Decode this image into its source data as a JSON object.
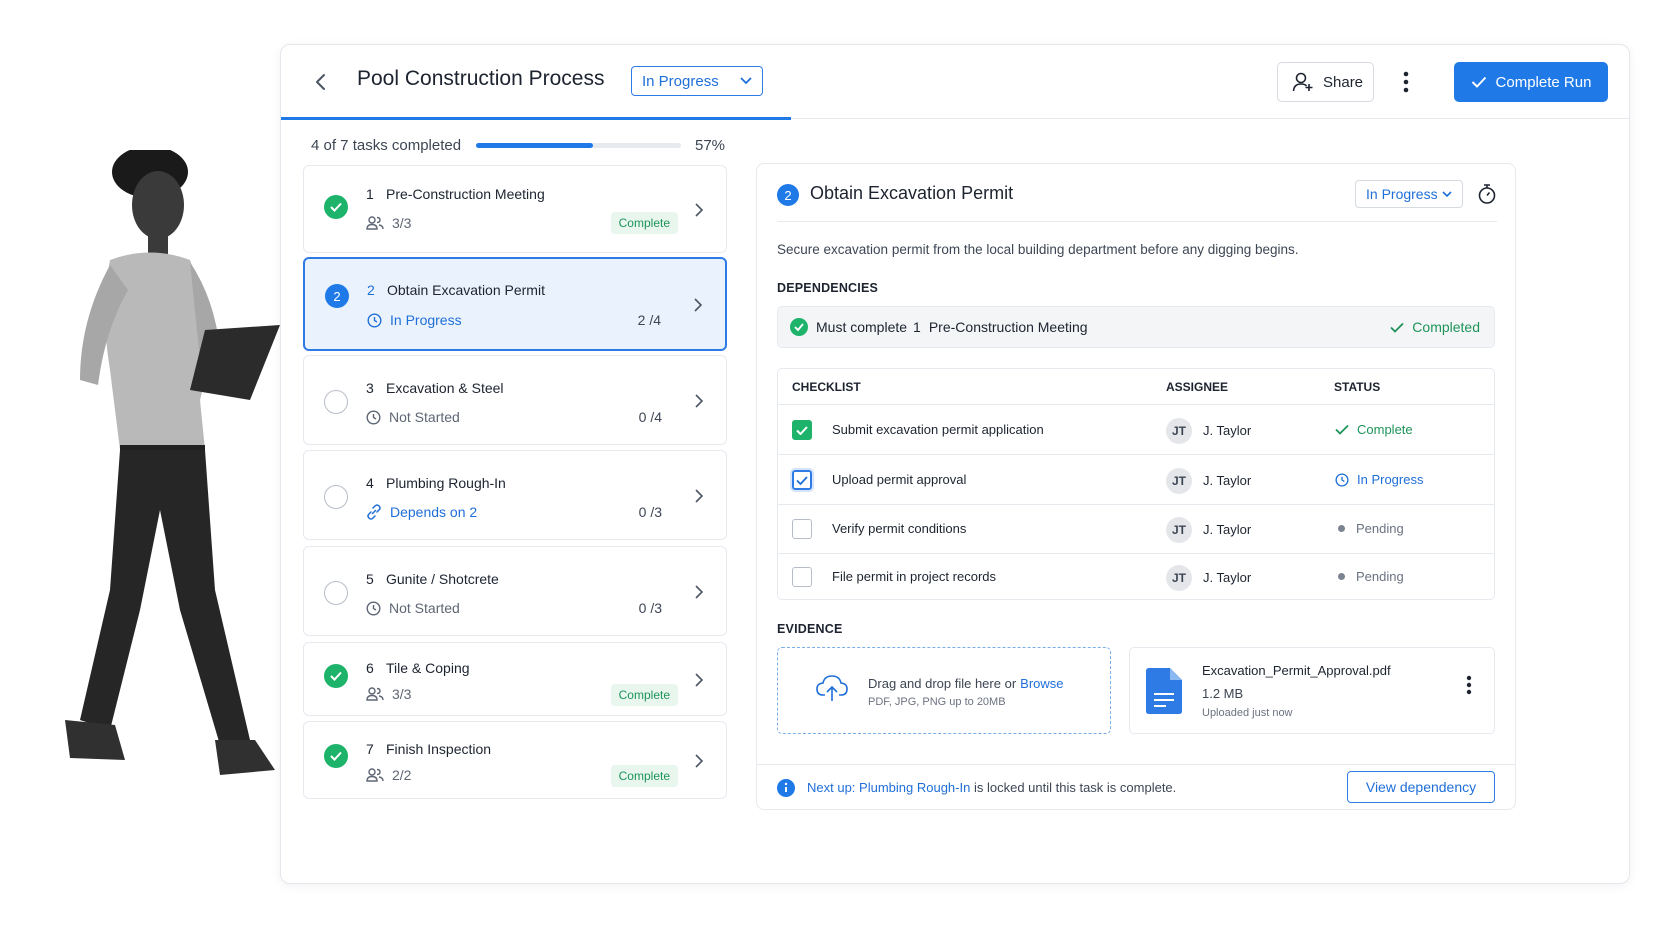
{
  "header": {
    "title": "Pool Construction Process",
    "status": "In Progress",
    "share_label": "Share",
    "complete_run_label": "Complete Run"
  },
  "progress": {
    "text": "4 of 7 tasks completed",
    "percent_label": "57%",
    "fraction": 0.57
  },
  "tasks": [
    {
      "num": "1",
      "title": "Pre-Construction Meeting",
      "state": "done",
      "meta": "3/3",
      "badge": "Complete"
    },
    {
      "num": "2",
      "title": "Obtain Excavation Permit",
      "state": "active",
      "meta": "In Progress",
      "count": "2 /4"
    },
    {
      "num": "3",
      "title": "Excavation & Steel",
      "state": "todo",
      "meta": "Not Started",
      "count": "0 /4"
    },
    {
      "num": "4",
      "title": "Plumbing Rough-In",
      "state": "todo",
      "meta": "Depends on 2",
      "count": "0 /3"
    },
    {
      "num": "5",
      "title": "Gunite / Shotcrete",
      "state": "todo",
      "meta": "Not Started",
      "count": "0 /3"
    },
    {
      "num": "6",
      "title": "Tile & Coping",
      "state": "done",
      "meta": "3/3",
      "badge": "Complete"
    },
    {
      "num": "7",
      "title": "Finish Inspection",
      "state": "done",
      "meta": "2/2",
      "badge": "Complete"
    }
  ],
  "detail": {
    "num": "2",
    "title": "Obtain Excavation Permit",
    "status": "In Progress",
    "description": "Secure excavation permit from the local building department before any digging begins.",
    "dependencies_label": "DEPENDENCIES",
    "dependency": {
      "prefix": "Must complete",
      "num": "1",
      "title": "Pre-Construction Meeting",
      "status": "Completed"
    },
    "checklist": {
      "headers": {
        "item": "CHECKLIST",
        "assignee": "ASSIGNEE",
        "status": "STATUS"
      },
      "rows": [
        {
          "item": "Submit excavation permit application",
          "initials": "JT",
          "assignee": "J. Taylor",
          "status": "Complete",
          "state": "checked"
        },
        {
          "item": "Upload permit approval",
          "initials": "JT",
          "assignee": "J. Taylor",
          "status": "In Progress",
          "state": "focus"
        },
        {
          "item": "Verify permit conditions",
          "initials": "JT",
          "assignee": "J. Taylor",
          "status": "Pending",
          "state": "empty"
        },
        {
          "item": "File permit in project records",
          "initials": "JT",
          "assignee": "J. Taylor",
          "status": "Pending",
          "state": "empty"
        }
      ]
    },
    "evidence": {
      "label": "EVIDENCE",
      "drop_text": "Drag and drop file here or",
      "browse_label": "Browse",
      "drop_hint": "PDF, JPG, PNG up to 20MB",
      "file_name": "Excavation_Permit_Approval.pdf",
      "file_size": "1.2 MB",
      "file_time": "Uploaded just now"
    },
    "footer": {
      "next_label": "Next up:",
      "next_task": "Plumbing Rough-In",
      "suffix": "is locked until this task is complete.",
      "button": "View dependency"
    }
  },
  "colors": {
    "accent": "#1f7ae8",
    "success": "#1db36a",
    "muted": "#6b7280"
  }
}
